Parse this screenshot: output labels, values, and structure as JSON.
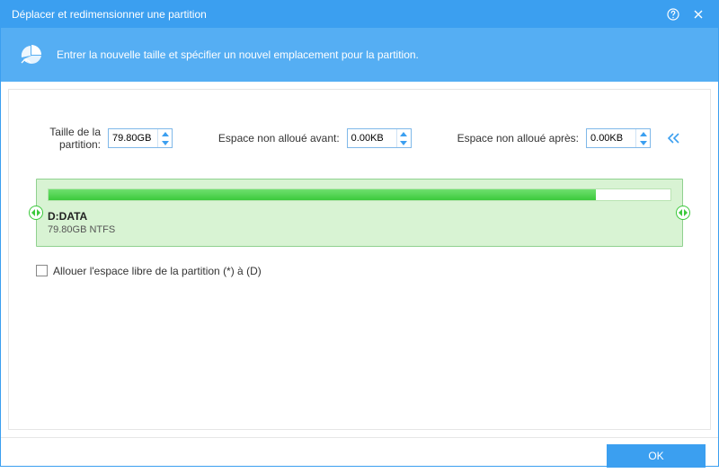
{
  "window": {
    "title": "Déplacer et redimensionner une partition"
  },
  "banner": {
    "text": "Entrer la nouvelle taille et spécifier un nouvel emplacement pour la partition."
  },
  "fields": {
    "size_label": "Taille de la partition:",
    "size_value": "79.80GB",
    "before_label": "Espace non alloué avant:",
    "before_value": "0.00KB",
    "after_label": "Espace non alloué après:",
    "after_value": "0.00KB"
  },
  "partition": {
    "name": "D:DATA",
    "subtitle": "79.80GB NTFS",
    "fill_percent": 88
  },
  "checkbox": {
    "label": "Allouer l'espace libre de la partition (*) à (D)"
  },
  "footer": {
    "ok": "OK"
  }
}
